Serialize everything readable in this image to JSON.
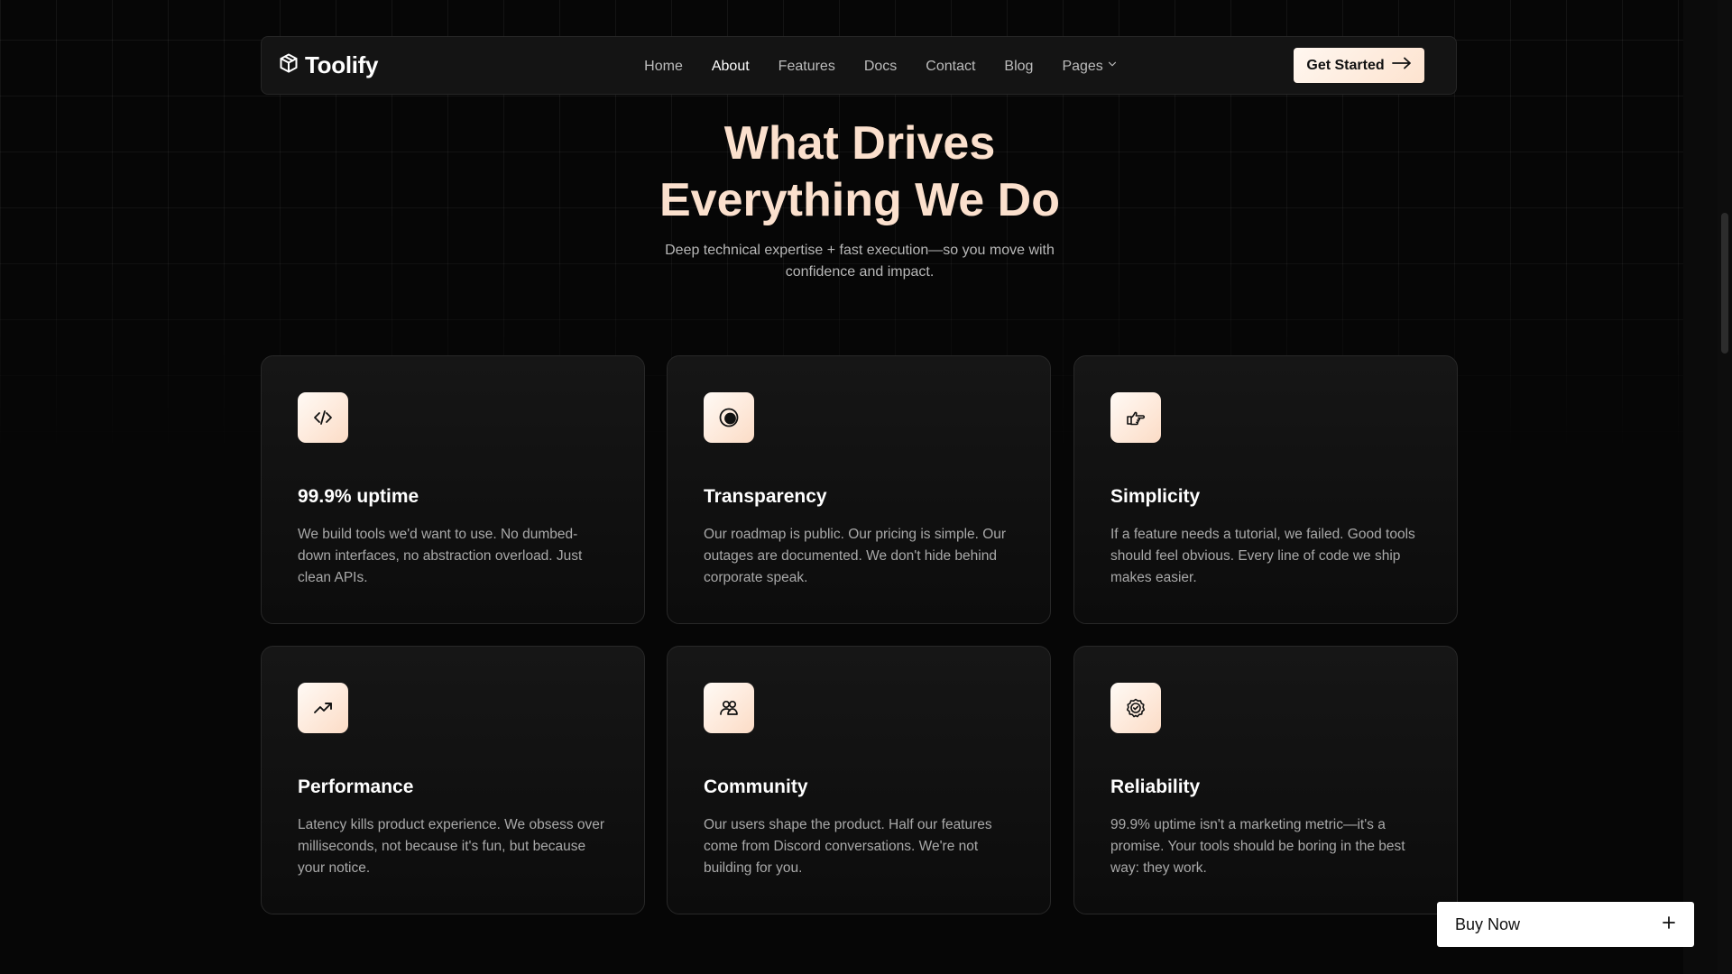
{
  "brand": {
    "name": "Toolify",
    "logo_icon": "cube-icon"
  },
  "nav": {
    "links": [
      {
        "label": "Home",
        "active": false
      },
      {
        "label": "About",
        "active": true
      },
      {
        "label": "Features",
        "active": false
      },
      {
        "label": "Docs",
        "active": false
      },
      {
        "label": "Contact",
        "active": false
      },
      {
        "label": "Blog",
        "active": false
      }
    ],
    "pages_label": "Pages",
    "pages_icon": "chevron-down-icon"
  },
  "cta": {
    "label": "Get Started",
    "icon": "arrow-right-icon"
  },
  "hero": {
    "title_line1": "What Drives",
    "title_line2": "Everything We Do",
    "subtitle": "Deep technical expertise + fast execution—so you move with confidence and impact."
  },
  "cards": [
    {
      "icon": "code-icon",
      "title": "99.9% uptime",
      "text": "We build tools we'd want to use. No dumbed-down interfaces, no abstraction overload. Just clean APIs."
    },
    {
      "icon": "aperture-icon",
      "title": "Transparency",
      "text": "Our roadmap is public. Our pricing is simple. Our outages are documented. We don't hide behind corporate speak."
    },
    {
      "icon": "pointing-hand-icon",
      "title": "Simplicity",
      "text": "If a feature needs a tutorial, we failed. Good tools should feel obvious. Every line of code we ship makes easier."
    },
    {
      "icon": "trending-up-icon",
      "title": "Performance",
      "text": "Latency kills product experience. We obsess over milliseconds, not because it's fun, but because your notice."
    },
    {
      "icon": "users-icon",
      "title": "Community",
      "text": "Our users shape the product. Half our features come from Discord conversations. We're not building for you."
    },
    {
      "icon": "badge-check-icon",
      "title": "Reliability",
      "text": "99.9% uptime isn't a marketing metric—it's a promise. Your tools should be boring in the best way: they  work."
    }
  ],
  "buy_now": {
    "label": "Buy Now",
    "icon": "plus-icon"
  },
  "colors": {
    "accent": "#fbe0cd",
    "background": "#060606",
    "card_bg": "#141414"
  }
}
